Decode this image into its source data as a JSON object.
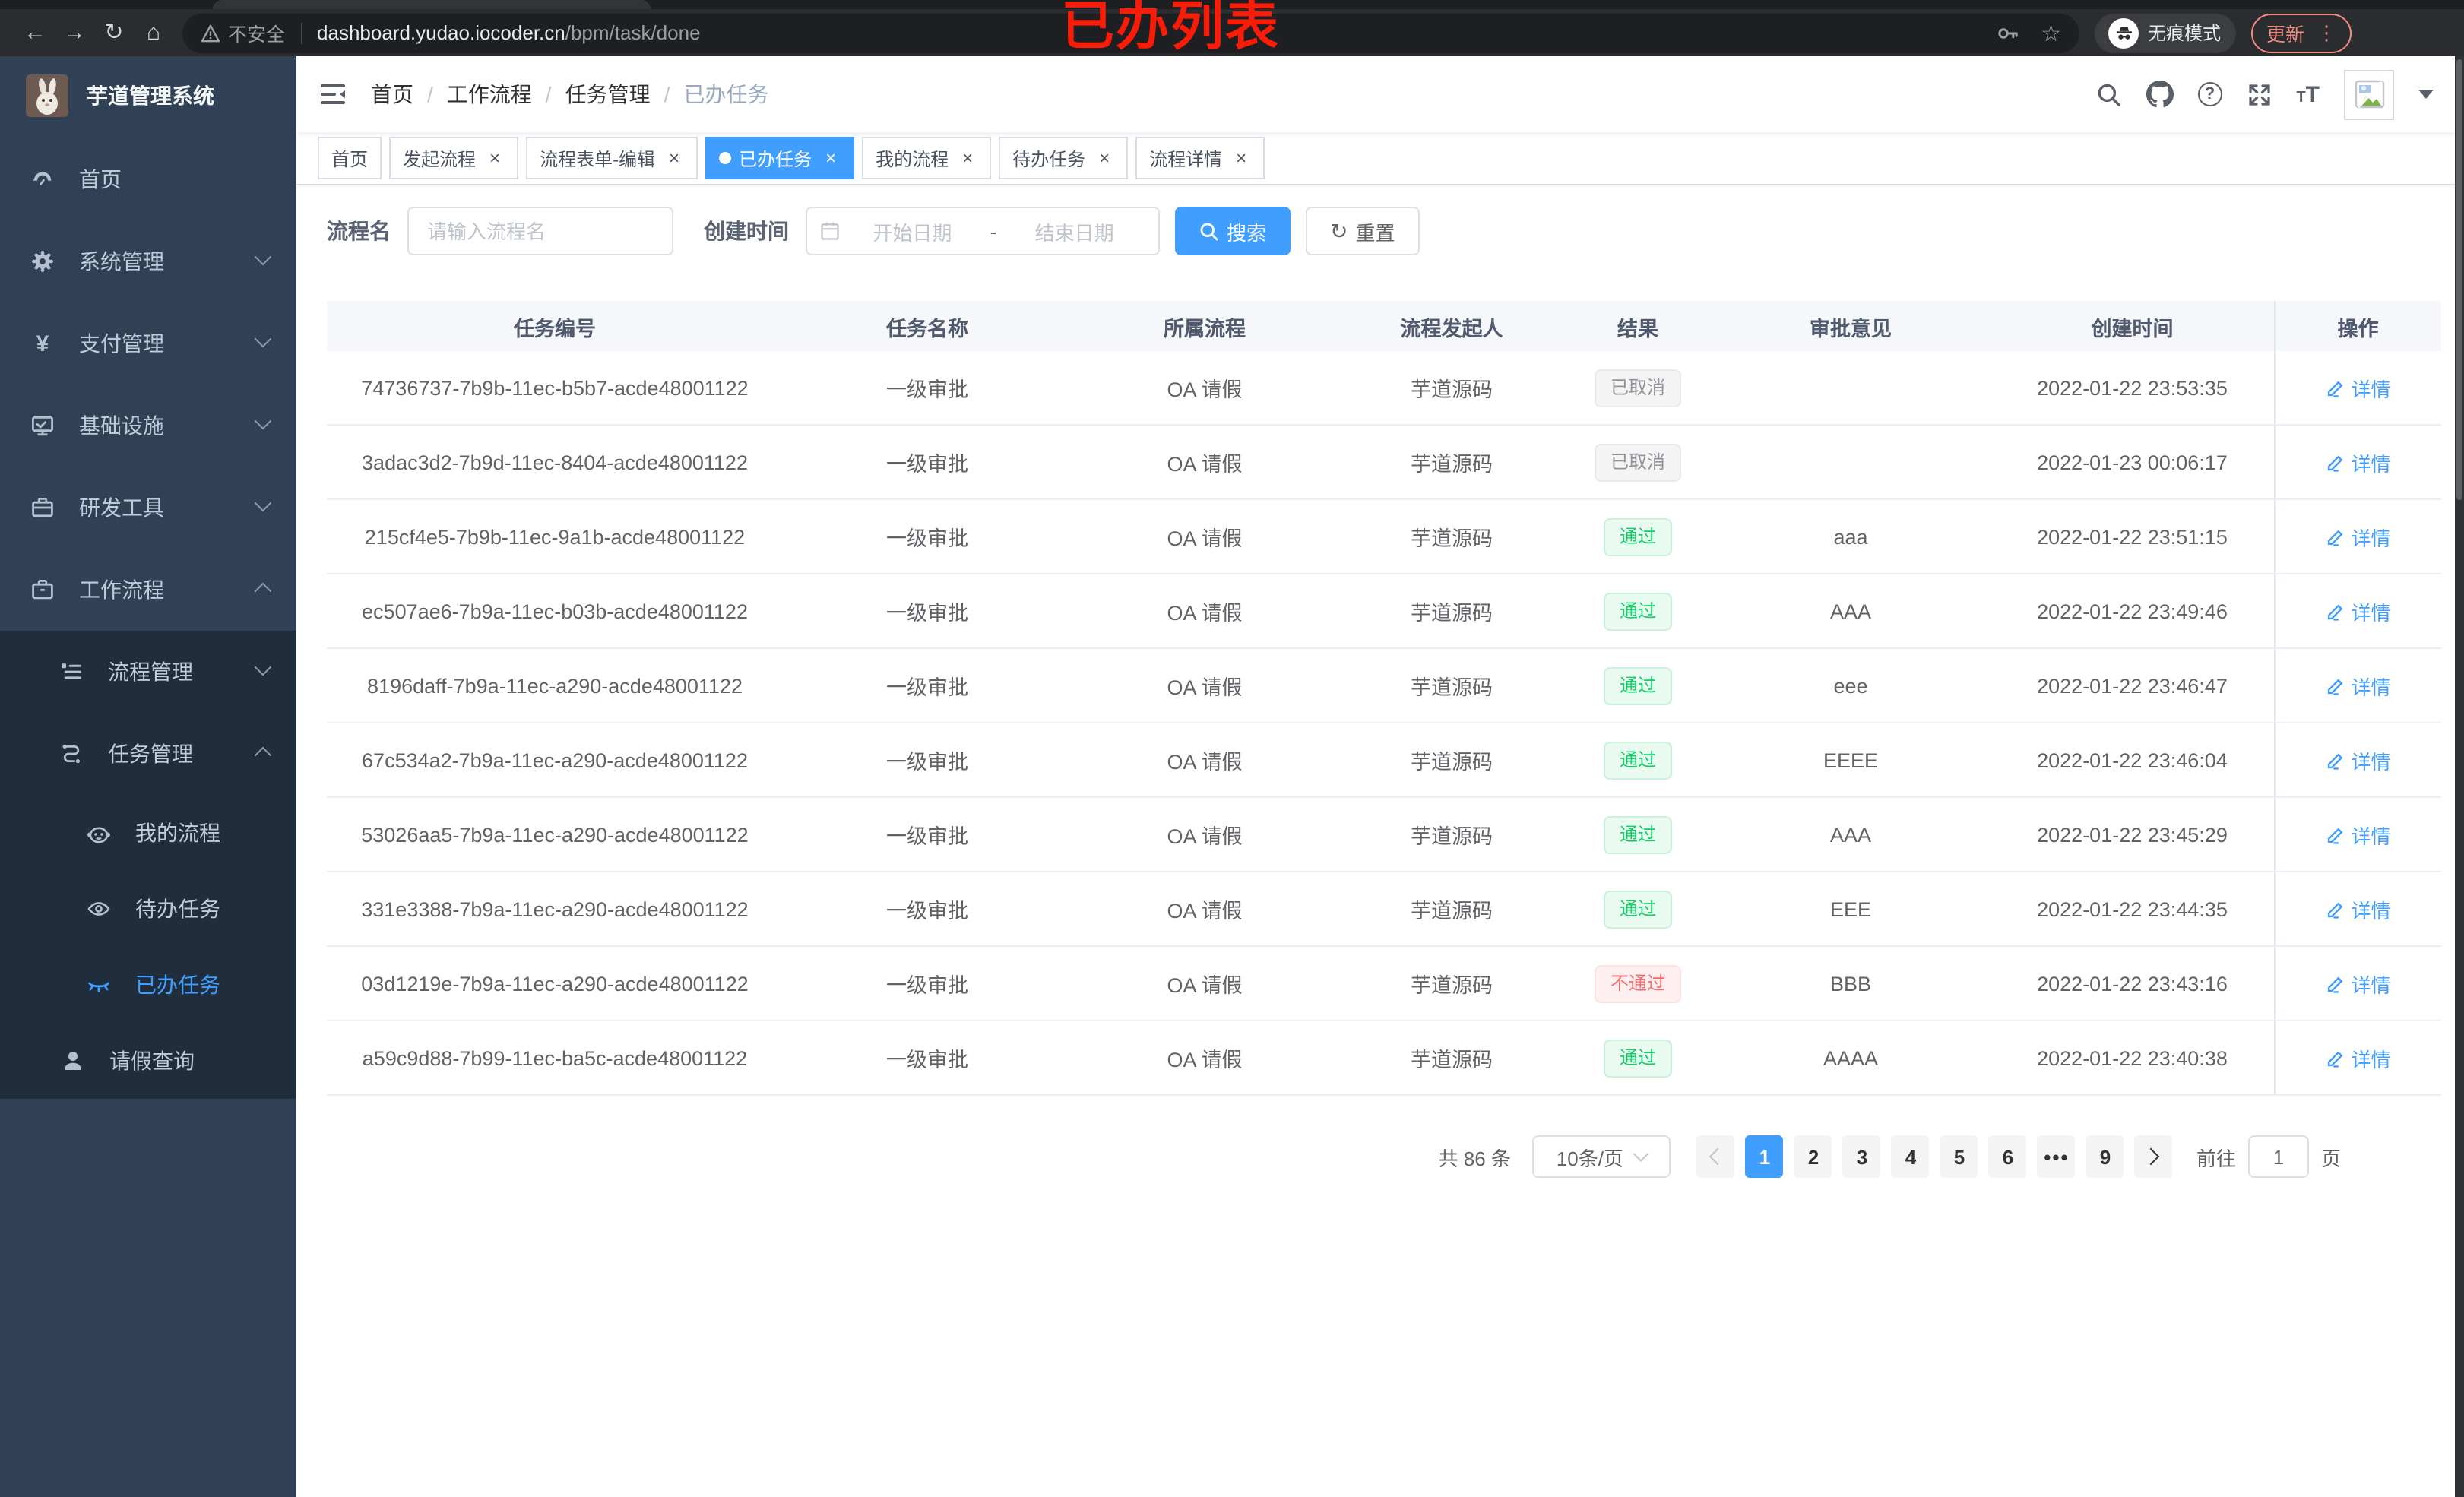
{
  "browser": {
    "insecure_label": "不安全",
    "url_host": "dashboard.yudao.iocoder.cn",
    "url_path": "/bpm/task/done",
    "incognito_label": "无痕模式",
    "update_label": "更新",
    "glyphs": {
      "back": "←",
      "forward": "→",
      "reload": "↻",
      "home": "⌂",
      "star": "☆",
      "menu_dots": "⋮"
    }
  },
  "annotation": {
    "title": "已办列表"
  },
  "sidebar": {
    "app_title": "芋道管理系统",
    "menu": [
      "首页",
      "系统管理",
      "支付管理",
      "基础设施",
      "研发工具",
      "工作流程",
      "流程管理",
      "任务管理",
      "我的流程",
      "待办任务",
      "已办任务",
      "请假查询"
    ]
  },
  "breadcrumb": {
    "separator": "/",
    "items": [
      "首页",
      "工作流程",
      "任务管理",
      "已办任务"
    ]
  },
  "tabs": {
    "close_glyph": "×",
    "items": [
      {
        "label": "首页",
        "closable": false,
        "state": ""
      },
      {
        "label": "发起流程",
        "closable": true,
        "state": ""
      },
      {
        "label": "流程表单-编辑",
        "closable": true,
        "state": ""
      },
      {
        "label": "已办任务",
        "closable": true,
        "state": "active"
      },
      {
        "label": "我的流程",
        "closable": true,
        "state": ""
      },
      {
        "label": "待办任务",
        "closable": true,
        "state": ""
      },
      {
        "label": "流程详情",
        "closable": true,
        "state": ""
      }
    ]
  },
  "filters": {
    "name_label": "流程名",
    "name_placeholder": "请输入流程名",
    "time_label": "创建时间",
    "start_placeholder": "开始日期",
    "range_separator": "-",
    "end_placeholder": "结束日期",
    "search_label": "搜索",
    "reset_label": "重置"
  },
  "table": {
    "columns": [
      "任务编号",
      "任务名称",
      "所属流程",
      "流程发起人",
      "结果",
      "审批意见",
      "创建时间",
      "操作"
    ],
    "detail_label": "详情",
    "rows": [
      {
        "id": "74736737-7b9b-11ec-b5b7-acde48001122",
        "name": "一级审批",
        "process": "OA 请假",
        "starter": "芋道源码",
        "result": "已取消",
        "result_type": "info",
        "comment": "",
        "time": "2022-01-22 23:53:35"
      },
      {
        "id": "3adac3d2-7b9d-11ec-8404-acde48001122",
        "name": "一级审批",
        "process": "OA 请假",
        "starter": "芋道源码",
        "result": "已取消",
        "result_type": "info",
        "comment": "",
        "time": "2022-01-23 00:06:17"
      },
      {
        "id": "215cf4e5-7b9b-11ec-9a1b-acde48001122",
        "name": "一级审批",
        "process": "OA 请假",
        "starter": "芋道源码",
        "result": "通过",
        "result_type": "success",
        "comment": "aaa",
        "time": "2022-01-22 23:51:15"
      },
      {
        "id": "ec507ae6-7b9a-11ec-b03b-acde48001122",
        "name": "一级审批",
        "process": "OA 请假",
        "starter": "芋道源码",
        "result": "通过",
        "result_type": "success",
        "comment": "AAA",
        "time": "2022-01-22 23:49:46"
      },
      {
        "id": "8196daff-7b9a-11ec-a290-acde48001122",
        "name": "一级审批",
        "process": "OA 请假",
        "starter": "芋道源码",
        "result": "通过",
        "result_type": "success",
        "comment": "eee",
        "time": "2022-01-22 23:46:47"
      },
      {
        "id": "67c534a2-7b9a-11ec-a290-acde48001122",
        "name": "一级审批",
        "process": "OA 请假",
        "starter": "芋道源码",
        "result": "通过",
        "result_type": "success",
        "comment": "EEEE",
        "time": "2022-01-22 23:46:04"
      },
      {
        "id": "53026aa5-7b9a-11ec-a290-acde48001122",
        "name": "一级审批",
        "process": "OA 请假",
        "starter": "芋道源码",
        "result": "通过",
        "result_type": "success",
        "comment": "AAA",
        "time": "2022-01-22 23:45:29"
      },
      {
        "id": "331e3388-7b9a-11ec-a290-acde48001122",
        "name": "一级审批",
        "process": "OA 请假",
        "starter": "芋道源码",
        "result": "通过",
        "result_type": "success",
        "comment": "EEE",
        "time": "2022-01-22 23:44:35"
      },
      {
        "id": "03d1219e-7b9a-11ec-a290-acde48001122",
        "name": "一级审批",
        "process": "OA 请假",
        "starter": "芋道源码",
        "result": "不通过",
        "result_type": "danger",
        "comment": "BBB",
        "time": "2022-01-22 23:43:16"
      },
      {
        "id": "a59c9d88-7b99-11ec-ba5c-acde48001122",
        "name": "一级审批",
        "process": "OA 请假",
        "starter": "芋道源码",
        "result": "通过",
        "result_type": "success",
        "comment": "AAAA",
        "time": "2022-01-22 23:40:38"
      }
    ]
  },
  "pagination": {
    "total_label": "共 86 条",
    "page_size": "10条/页",
    "pages": [
      {
        "label": "1",
        "state": "active"
      },
      {
        "label": "2",
        "state": ""
      },
      {
        "label": "3",
        "state": ""
      },
      {
        "label": "4",
        "state": ""
      },
      {
        "label": "5",
        "state": ""
      },
      {
        "label": "6",
        "state": ""
      },
      {
        "label": "•••",
        "state": "more"
      },
      {
        "label": "9",
        "state": ""
      }
    ],
    "goto_label": "前往",
    "goto_value": "1",
    "page_unit": "页"
  },
  "colors": {
    "accent": "#409eff",
    "success": "#13ce66",
    "danger": "#f56c6c",
    "info": "#909399",
    "annotation_red": "#f91c08",
    "sidebar_bg": "#304156",
    "submenu_bg": "#1f2d3d"
  }
}
